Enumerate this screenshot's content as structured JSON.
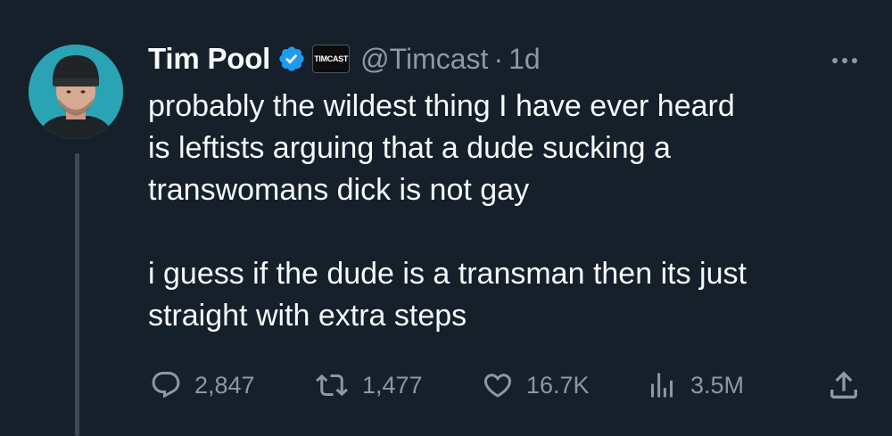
{
  "tweet": {
    "author_name": "Tim Pool",
    "affiliation_badge": "TIMCAST",
    "handle": "@Timcast",
    "separator": "·",
    "time": "1d",
    "text_lines": [
      "probably the wildest thing I have ever heard",
      "is leftists arguing that a dude sucking a",
      "transwomans dick is not gay",
      "",
      "i guess if the dude is a transman then its just",
      "straight with extra steps"
    ]
  },
  "actions": {
    "replies": "2,847",
    "retweets": "1,477",
    "likes": "16.7K",
    "views": "3.5M"
  },
  "icons": {
    "verified": "verified-badge-icon",
    "more": "more-dots-icon",
    "reply": "reply-icon",
    "retweet": "retweet-icon",
    "like": "heart-icon",
    "views": "bar-chart-icon",
    "share": "share-icon"
  },
  "colors": {
    "background": "#15202b",
    "primary_text": "#f7f9f9",
    "secondary_text": "#8b98a5",
    "verified_blue": "#1d9bf0",
    "thread_line": "#3b4956"
  }
}
